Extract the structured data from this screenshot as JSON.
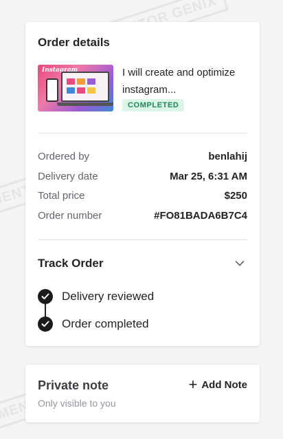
{
  "order_details": {
    "title": "Order details",
    "gig": {
      "title": "I will create and optimize instagram...",
      "thumbnail_text": "Instagram",
      "status": "COMPLETED",
      "status_colors": {
        "bg": "#dbf6e7",
        "fg": "#1a8a55"
      }
    },
    "details": [
      {
        "label": "Ordered by",
        "value": "benlahij"
      },
      {
        "label": "Delivery date",
        "value": "Mar 25, 6:31 AM"
      },
      {
        "label": "Total price",
        "value": "$250"
      },
      {
        "label": "Order number",
        "value": "#FO81BADA6B7C4"
      }
    ]
  },
  "track_order": {
    "title": "Track Order",
    "expand_icon": "chevron-down-icon",
    "steps": [
      {
        "label": "Delivery reviewed",
        "icon": "check-circle-icon"
      },
      {
        "label": "Order completed",
        "icon": "check-circle-icon"
      }
    ]
  },
  "private_note": {
    "title": "Private note",
    "subtitle": "Only visible to you",
    "add_label": "Add Note",
    "add_icon": "plus-icon"
  },
  "watermark": {
    "text": "MENTOR GENIX"
  }
}
